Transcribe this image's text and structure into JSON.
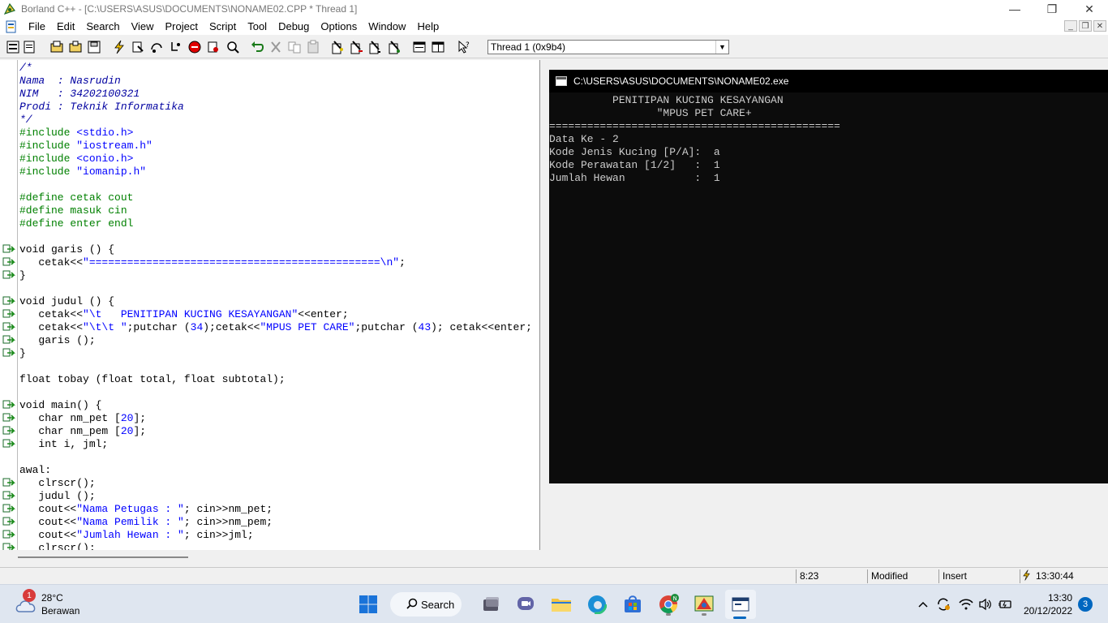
{
  "window": {
    "title": "Borland C++ - [C:\\USERS\\ASUS\\DOCUMENTS\\NONAME02.CPP * Thread 1]",
    "controls": [
      "—",
      "❐",
      "✕"
    ]
  },
  "menu": [
    "File",
    "Edit",
    "Search",
    "View",
    "Project",
    "Script",
    "Tool",
    "Debug",
    "Options",
    "Window",
    "Help"
  ],
  "toolbar": {
    "thread_select": "Thread 1 (0x9b4)"
  },
  "editor": {
    "lines": [
      "/*",
      "Nama  : Nasrudin",
      "NIM   : 34202100321",
      "Prodi : Teknik Informatika",
      "*/",
      "#include <stdio.h>",
      "#include \"iostream.h\"",
      "#include <conio.h>",
      "#include \"iomanip.h\"",
      "",
      "#define cetak cout",
      "#define masuk cin",
      "#define enter endl",
      "",
      "void garis () {",
      "   cetak<<\"==============================================\\n\";",
      "}",
      "",
      "void judul () {",
      "   cetak<<\"\\t   PENITIPAN KUCING KESAYANGAN\"<<enter;",
      "   cetak<<\"\\t\\t \";putchar (34);cetak<<\"MPUS PET CARE\";putchar (43); cetak<<enter;",
      "   garis ();",
      "}",
      "",
      "float tobay (float total, float subtotal);",
      "",
      "void main() {",
      "   char nm_pet [20];",
      "   char nm_pem [20];",
      "   int i, jml;",
      "",
      "awal:",
      "   clrscr();",
      "   judul ();",
      "   cout<<\"Nama Petugas : \"; cin>>nm_pet;",
      "   cout<<\"Nama Pemilik : \"; cin>>nm_pem;",
      "   cout<<\"Jumlah Hewan : \"; cin>>jml;",
      "   clrscr();"
    ]
  },
  "console": {
    "title": "C:\\USERS\\ASUS\\DOCUMENTS\\NONAME02.exe",
    "lines": [
      "          PENITIPAN KUCING KESAYANGAN",
      "                 \"MPUS PET CARE+",
      "==============================================",
      "Data Ke - 2",
      "Kode Jenis Kucing [P/A]:  a",
      "Kode Perawatan [1/2]   :  1",
      "Jumlah Hewan           :  1"
    ]
  },
  "status": {
    "position": "8:23",
    "modified": "Modified",
    "mode": "Insert",
    "time": "13:30:44"
  },
  "taskbar": {
    "weather_temp": "28°C",
    "weather_cond": "Berawan",
    "weather_badge": "1",
    "search_label": "Search",
    "clock_time": "13:30",
    "clock_date": "20/12/2022",
    "notif_count": "3"
  },
  "colors": {
    "accent": "#0067c0",
    "console_bg": "#0c0c0c",
    "code_string": "#0000ff",
    "code_preproc": "#008000"
  }
}
